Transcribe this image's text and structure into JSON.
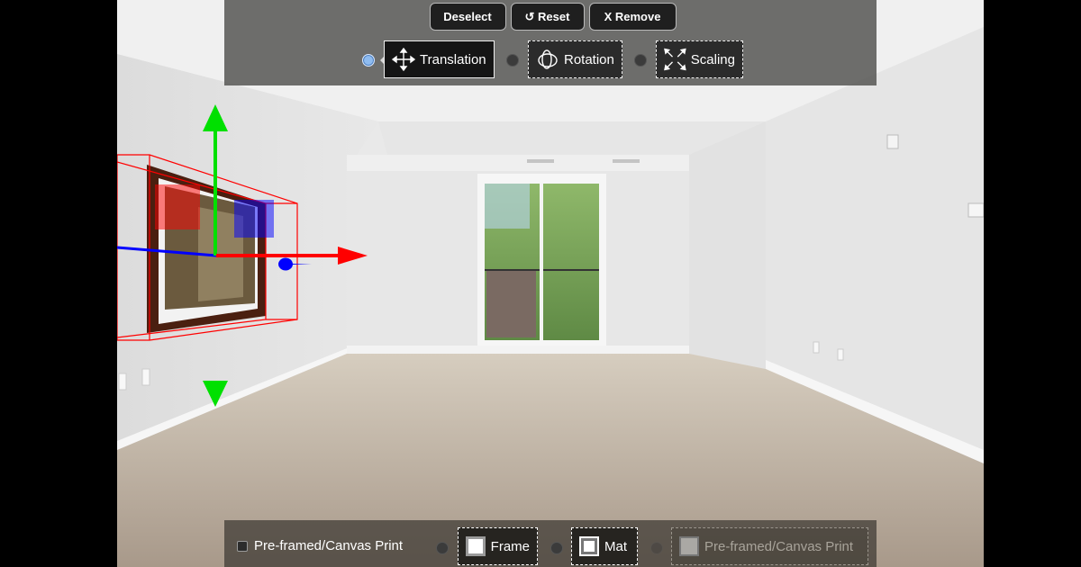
{
  "toolbar": {
    "deselect_label": "Deselect",
    "reset_label": "↺ Reset",
    "remove_label": "X Remove",
    "modes": [
      {
        "label": "Translation",
        "icon": "move-arrows-icon",
        "selected": true
      },
      {
        "label": "Rotation",
        "icon": "rotate-orbit-icon",
        "selected": false
      },
      {
        "label": "Scaling",
        "icon": "scale-arrows-icon",
        "selected": false
      }
    ]
  },
  "bottom_bar": {
    "checkbox_label": "Pre-framed/Canvas Print",
    "checkbox_checked": false,
    "options": [
      {
        "label": "Frame",
        "icon": "frame-thumbnail-icon",
        "enabled": true
      },
      {
        "label": "Mat",
        "icon": "mat-thumbnail-icon",
        "enabled": true
      },
      {
        "label": "Pre-framed/Canvas Print",
        "icon": "canvas-thumbnail-icon",
        "enabled": false
      }
    ]
  },
  "gizmo": {
    "x_axis_color": "#ff0000",
    "y_axis_color": "#00e000",
    "z_axis_color": "#0000ff",
    "bbox_color": "#ff0000"
  }
}
